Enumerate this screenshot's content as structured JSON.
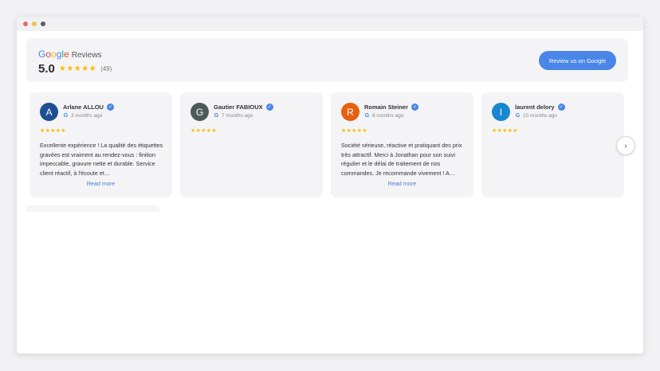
{
  "header": {
    "logo_letters": [
      "G",
      "o",
      "o",
      "g",
      "l",
      "e"
    ],
    "logo_colors": [
      "#4285f4",
      "#ea4335",
      "#fbbc04",
      "#4285f4",
      "#34a853",
      "#ea4335"
    ],
    "logo_reviews": "Reviews",
    "rating": "5.0",
    "stars": "★★★★★",
    "count": "(49)",
    "cta_label": "Review us on Google"
  },
  "reviews": [
    {
      "initial": "A",
      "avatar_color": "#1d4f91",
      "name": "Arlane ALLOU",
      "time": "3 months ago",
      "stars": "★★★★★",
      "text": "Excellente expérience ! La qualité des étiquettes gravées est vraiment au rendez-vous : finition impeccable, gravure nette et durable. Service client réactif, à l'écoute et…",
      "read_more": "Read more"
    },
    {
      "initial": "G",
      "avatar_color": "#4b5a58",
      "name": "Gautier FABIOUX",
      "time": "7 months ago",
      "stars": "★★★★★",
      "text": "",
      "read_more": ""
    },
    {
      "initial": "R",
      "avatar_color": "#e8600f",
      "name": "Romain Steiner",
      "time": "8 months ago",
      "stars": "★★★★★",
      "text": "Société sérieuse, réactive et pratiquant des prix très attractif. Merci à Jonathan pour son suivi régulier et le délai de traitement de nos commandes. Je recommande vivement ! A…",
      "read_more": "Read more"
    },
    {
      "initial": "l",
      "avatar_color": "#1788d0",
      "name": "laurent delory",
      "time": "10 months ago",
      "stars": "★★★★★",
      "text": "",
      "read_more": ""
    }
  ],
  "verified_icon": "✓",
  "google_mini": "G",
  "next_arrow": "›"
}
